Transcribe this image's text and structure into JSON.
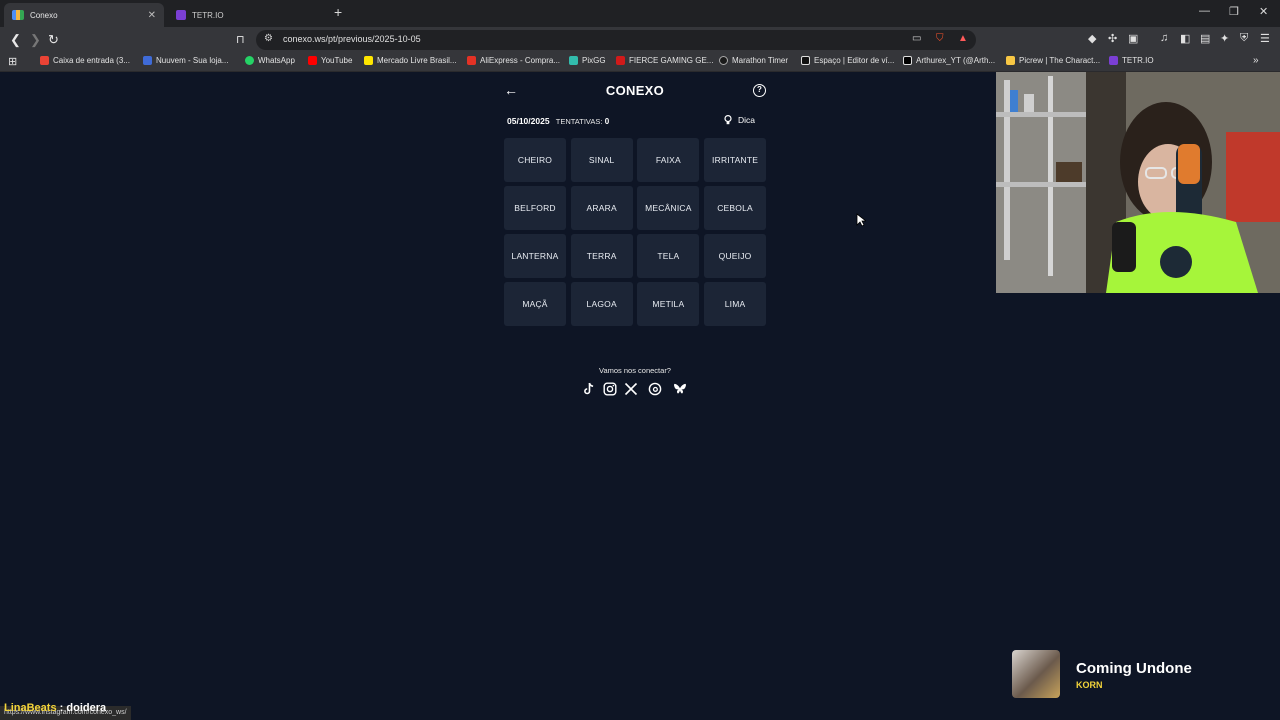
{
  "browser": {
    "tabs": [
      {
        "title": "Conexo",
        "active": true
      },
      {
        "title": "TETR.IO",
        "active": false
      }
    ],
    "url": "conexo.ws/pt/previous/2025-10-05",
    "bookmarks": [
      {
        "label": "Caixa de entrada (3...",
        "color": "#ea4335"
      },
      {
        "label": "Nuuvem - Sua loja...",
        "color": "#3f6bd8"
      },
      {
        "label": "WhatsApp",
        "color": "#25d366"
      },
      {
        "label": "YouTube",
        "color": "#ff0000"
      },
      {
        "label": "Mercado Livre Brasil...",
        "color": "#ffe600"
      },
      {
        "label": "AliExpress - Compra...",
        "color": "#e43225"
      },
      {
        "label": "PixGG",
        "color": "#32bcad"
      },
      {
        "label": "FIERCE GAMING GE...",
        "color": "#d11a1a"
      },
      {
        "label": "Marathon Timer",
        "color": "#1b1b1b"
      },
      {
        "label": "Espaço | Editor de ví...",
        "color": "#111111"
      },
      {
        "label": "Arthurex_YT (@Arth...",
        "color": "#000000"
      },
      {
        "label": "Picrew | The Charact...",
        "color": "#f7c744"
      },
      {
        "label": "TETR.IO",
        "color": "#7b3fd4"
      }
    ]
  },
  "game": {
    "title": "CONEXO",
    "date": "05/10/2025",
    "attempts_label": "TENTATIVAS:",
    "attempts_value": "0",
    "hint_label": "Dica",
    "words": [
      "CHEIRO",
      "SINAL",
      "FAIXA",
      "IRRITANTE",
      "BELFORD",
      "ARARA",
      "MECÂNICA",
      "CEBOLA",
      "LANTERNA",
      "TERRA",
      "TELA",
      "QUEIJO",
      "MAÇÃ",
      "LAGOA",
      "METILA",
      "LIMA"
    ],
    "social_title": "Vamos nos conectar?",
    "socials": [
      "tiktok-icon",
      "instagram-icon",
      "x-icon",
      "threads-icon",
      "bluesky-icon"
    ]
  },
  "overlay": {
    "now_playing": {
      "song": "Coming Undone",
      "artist": "KORN"
    },
    "chat": {
      "user": "LinaBeats",
      "separator": ":",
      "message": "doidera"
    },
    "status_url": "https://www.instagram.com/conexo_ws/"
  },
  "colors": {
    "background": "#0e1525",
    "tile": "#1c2536",
    "accent_yellow": "#f2d33a"
  }
}
